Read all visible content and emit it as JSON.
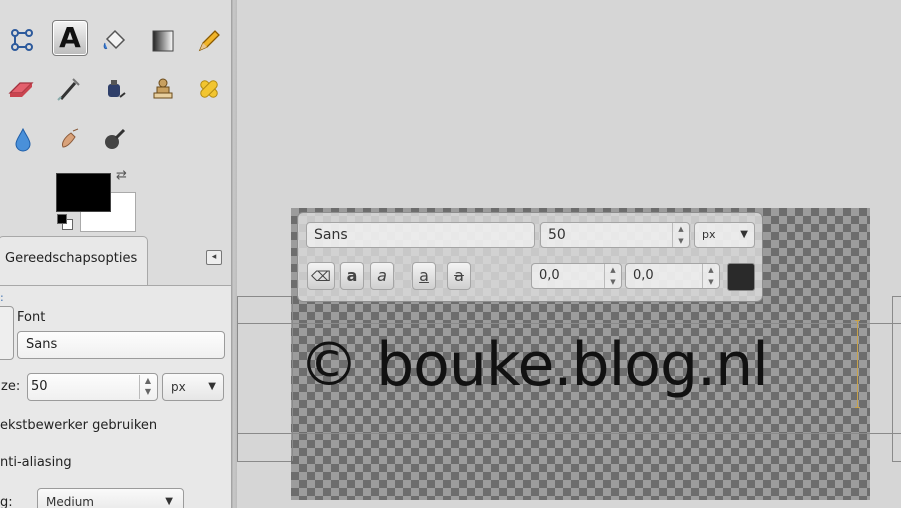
{
  "toolbox": {
    "tools_row1": [
      "paths-icon",
      "text-icon",
      "bucket-fill-icon",
      "gradient-icon",
      "pencil-icon"
    ],
    "tools_row2": [
      "eraser-icon",
      "airbrush-icon",
      "ink-icon",
      "clone-icon",
      "heal-icon"
    ],
    "tools_row3": [
      "blur-icon",
      "smudge-icon",
      "dodge-burn-icon"
    ],
    "foreground_color": "#000000",
    "background_color": "#ffffff"
  },
  "tab": {
    "label": "Gereedschapsopties"
  },
  "options": {
    "font_label": "Font",
    "font_value": "Sans",
    "size_label": "ze:",
    "size_value": "50",
    "size_unit": "px",
    "editor_label": "ekstbewerker gebruiken",
    "antialias_label": "nti-aliasing",
    "hinting_label": "g:",
    "hinting_value": "Medium"
  },
  "text_toolbar": {
    "font": "Sans",
    "size": "50",
    "unit": "px",
    "baseline": "0,0",
    "kerning": "0,0",
    "style_buttons": [
      "a",
      "a",
      "a",
      "a"
    ]
  },
  "canvas": {
    "text": "© bouke.blog.nl"
  }
}
